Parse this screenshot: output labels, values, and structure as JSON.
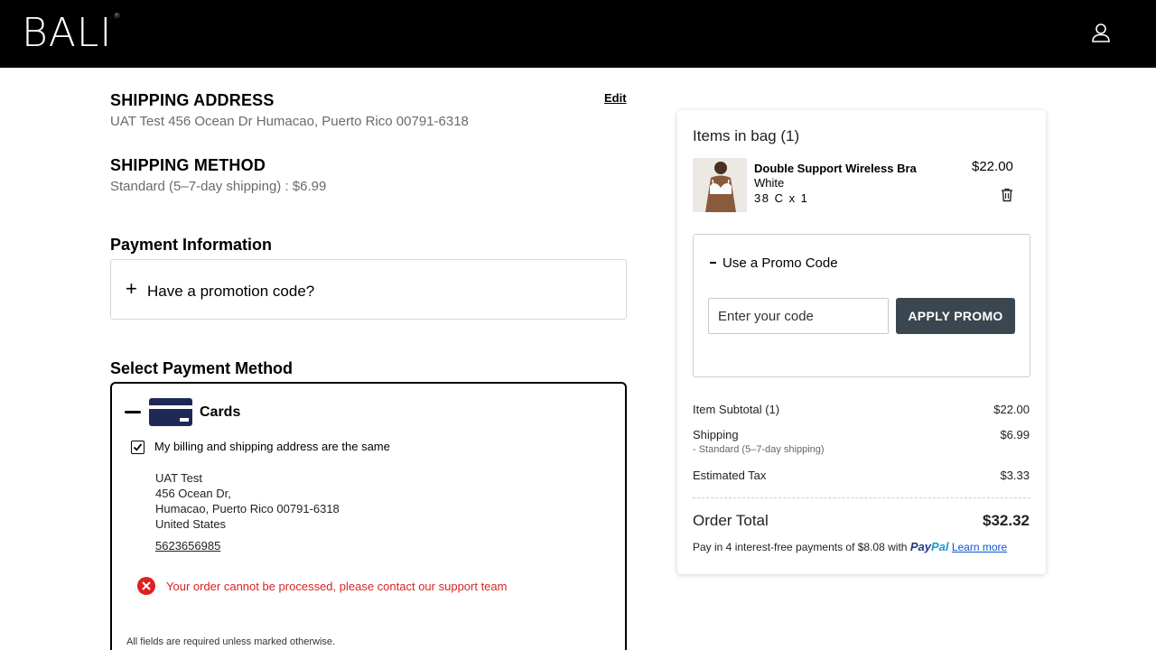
{
  "header": {
    "logo_text": "BALI",
    "logo_mark": "®",
    "account_icon": "user-icon"
  },
  "shipping_address": {
    "title": "SHIPPING ADDRESS",
    "edit_label": "Edit",
    "value": "UAT Test 456 Ocean Dr  Humacao, Puerto Rico 00791-6318"
  },
  "shipping_method": {
    "title": "SHIPPING METHOD",
    "value": "Standard (5–7-day shipping) : $6.99"
  },
  "payment_info": {
    "title": "Payment Information",
    "promo_toggle_label": "Have a promotion code?"
  },
  "payment_method": {
    "title": "Select Payment Method",
    "cards_label": "Cards",
    "billing_same_label": "My billing and shipping address are the same",
    "billing_same_checked": true,
    "address_lines": [
      "UAT Test",
      "456 Ocean Dr,",
      "Humacao, Puerto Rico 00791-6318",
      "United States"
    ],
    "phone": "5623656985",
    "error_message": "Your order cannot be processed, please contact our support team",
    "required_note": "All fields are required unless marked otherwise."
  },
  "summary": {
    "title": "Items in bag (1)",
    "item": {
      "name": "Double Support Wireless Bra",
      "color": "White",
      "size_qty": "38 C x 1",
      "price": "$22.00"
    },
    "promo": {
      "label": "Use a Promo Code",
      "input_placeholder": "Enter your code",
      "apply_label": "APPLY PROMO"
    },
    "subtotal_label": "Item Subtotal (1)",
    "subtotal_value": "$22.00",
    "shipping_label": "Shipping",
    "shipping_note": "- Standard (5–7-day shipping)",
    "shipping_value": "$6.99",
    "tax_label": "Estimated Tax",
    "tax_value": "$3.33",
    "total_label": "Order Total",
    "total_value": "$32.32",
    "paypal_text": "Pay in 4 interest-free payments of $8.08 with",
    "paypal_logo_a": "Pay",
    "paypal_logo_b": "Pal",
    "learn_more": "Learn more"
  },
  "colors": {
    "header_bg": "#000000",
    "button_bg": "#3a4650",
    "error": "#d92424",
    "card_icon": "#1e2a55"
  }
}
